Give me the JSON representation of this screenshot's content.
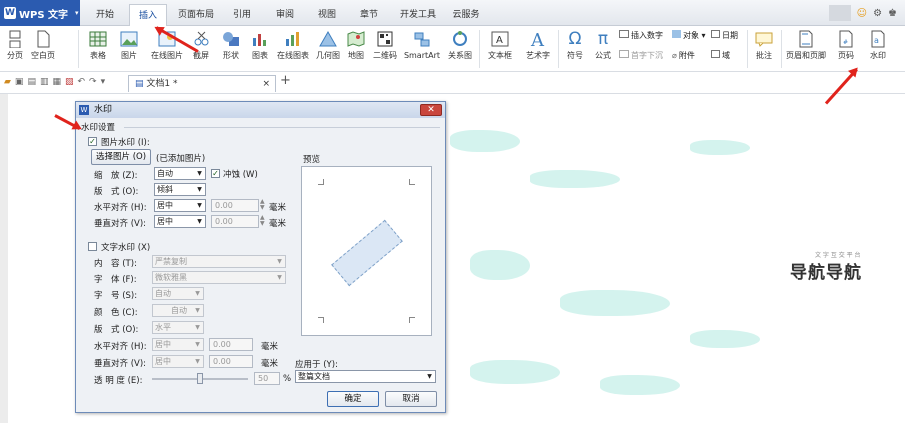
{
  "app": {
    "name": "WPS 文字",
    "logo_letter": "W"
  },
  "tabs": [
    "开始",
    "插入",
    "页面布局",
    "引用",
    "审阅",
    "视图",
    "章节",
    "开发工具",
    "云服务"
  ],
  "active_tab": "插入",
  "ribbon": {
    "items": [
      {
        "label": "分页",
        "icon": "page-break-icon"
      },
      {
        "label": "空白页",
        "icon": "blank-page-icon"
      },
      {
        "label": "表格",
        "icon": "table-icon"
      },
      {
        "label": "图片",
        "icon": "picture-icon"
      },
      {
        "label": "在线图片",
        "icon": "online-picture-icon"
      },
      {
        "label": "截屏",
        "icon": "screenshot-icon"
      },
      {
        "label": "形状",
        "icon": "shape-icon"
      },
      {
        "label": "图表",
        "icon": "chart-icon"
      },
      {
        "label": "在线图表",
        "icon": "online-chart-icon"
      },
      {
        "label": "几何图",
        "icon": "geometry-icon"
      },
      {
        "label": "地图",
        "icon": "map-icon"
      },
      {
        "label": "二维码",
        "icon": "qrcode-icon"
      },
      {
        "label": "SmartArt",
        "icon": "smartart-icon"
      },
      {
        "label": "关系图",
        "icon": "relation-icon"
      },
      {
        "label": "文本框",
        "icon": "textbox-icon"
      },
      {
        "label": "艺术字",
        "icon": "wordart-icon"
      },
      {
        "label": "符号",
        "icon": "symbol-icon"
      },
      {
        "label": "公式",
        "icon": "formula-icon"
      },
      {
        "label": "批注",
        "icon": "comment-icon"
      },
      {
        "label": "页眉和页脚",
        "icon": "header-footer-icon"
      },
      {
        "label": "页码",
        "icon": "page-number-icon"
      },
      {
        "label": "水印",
        "icon": "watermark-icon"
      }
    ],
    "small_items": [
      "插入数字",
      "首字下沉",
      "对象",
      "附件",
      "日期",
      "域"
    ]
  },
  "doc_tab": "文档1 *",
  "dialog": {
    "title": "水印",
    "group_label": "水印设置",
    "picture_wm": {
      "label": "图片水印",
      "hotkey": "(I):",
      "checked": "✓",
      "choose_button": "选择图片",
      "choose_hotkey": "(O)",
      "added_note": "(已添加图片)",
      "scale_label": "缩　放",
      "scale_hotkey": "(Z):",
      "scale_value": "自动",
      "washout_label": "冲蚀",
      "washout_hotkey": "(W)",
      "washout_checked": "✓",
      "layout_label": "版　式",
      "layout_hotkey": "(O):",
      "layout_value": "倾斜",
      "halign_label": "水平对齐",
      "halign_hotkey": "(H):",
      "halign_value": "居中",
      "halign_offset": "0.00",
      "valign_label": "垂直对齐",
      "valign_hotkey": "(V):",
      "valign_value": "居中",
      "valign_offset": "0.00",
      "unit": "毫米"
    },
    "text_wm": {
      "label": "文字水印",
      "hotkey": "(X)",
      "content_label": "内　容",
      "content_hotkey": "(T):",
      "content_value": "严禁复制",
      "font_label": "字　体",
      "font_hotkey": "(F):",
      "font_value": "微软雅黑",
      "size_label": "字　号",
      "size_hotkey": "(S):",
      "size_value": "自动",
      "color_label": "颜　色",
      "color_hotkey": "(C):",
      "color_value": "自动",
      "layout_label": "版　式",
      "layout_hotkey": "(O):",
      "layout_value": "水平",
      "halign_label": "水平对齐",
      "halign_hotkey": "(H):",
      "halign_value": "居中",
      "halign_offset": "0.00",
      "valign_label": "垂直对齐",
      "valign_hotkey": "(V):",
      "valign_value": "居中",
      "valign_offset": "0.00",
      "unit": "毫米",
      "transparency_label": "透 明 度",
      "transparency_hotkey": "(E):",
      "transparency_value": "50",
      "percent": "%",
      "transparency_fraction": 0.5
    },
    "preview_label": "预览",
    "apply_label": "应用于",
    "apply_hotkey": "(Y):",
    "apply_value": "整篇文档",
    "ok": "确定",
    "cancel": "取消"
  },
  "watermark_logo": "导航导航",
  "watermark_sub": "文 字 互 交 平 台",
  "colors": {
    "accent": "#2b5bb0",
    "arrow": "#e0231c"
  }
}
